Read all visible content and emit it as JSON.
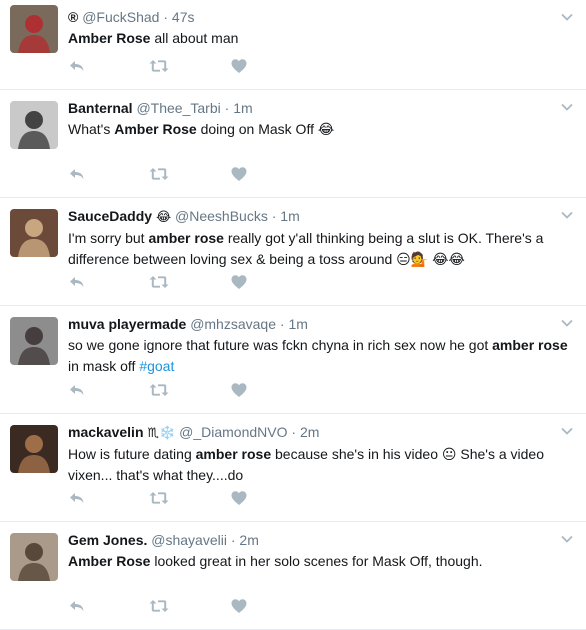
{
  "tweets": [
    {
      "name": "®",
      "name_emoji": "",
      "handle": "@FuckShad",
      "time": "47s",
      "text": [
        {
          "t": "Amber Rose",
          "b": true
        },
        {
          "t": " all about man"
        }
      ],
      "avatar": {
        "bg": "#7a6a5c",
        "fg": "#b8262a"
      }
    },
    {
      "name": "Banternal",
      "name_emoji": "",
      "handle": "@Thee_Tarbi",
      "time": "1m",
      "text": [
        {
          "t": "What's "
        },
        {
          "t": "Amber Rose",
          "b": true
        },
        {
          "t": " doing on Mask Off 😂"
        }
      ],
      "avatar": {
        "bg": "#c9c9c9",
        "fg": "#2b2b2b"
      }
    },
    {
      "name": "SauceDaddy",
      "name_emoji": "😂",
      "handle": "@NeeshBucks",
      "time": "1m",
      "text": [
        {
          "t": "I'm sorry but "
        },
        {
          "t": "amber rose",
          "b": true
        },
        {
          "t": " really got y'all thinking being a slut is OK. There's a difference between loving sex & being a toss around 😑💁 😂😂"
        }
      ],
      "avatar": {
        "bg": "#6b4a3a",
        "fg": "#d8b68c"
      }
    },
    {
      "name": "muva playermade",
      "name_emoji": "",
      "handle": "@mhzsavaqe",
      "time": "1m",
      "text": [
        {
          "t": "so we gone ignore that future was fckn chyna in rich sex now he got "
        },
        {
          "t": "amber rose",
          "b": true
        },
        {
          "t": " in mask off "
        },
        {
          "t": "#goat",
          "h": true
        }
      ],
      "avatar": {
        "bg": "#8d8d8d",
        "fg": "#3a3030"
      }
    },
    {
      "name": "mackavelin",
      "name_emoji": "♏❄️",
      "handle": "@_DiamondNVO",
      "time": "2m",
      "text": [
        {
          "t": "How is future dating "
        },
        {
          "t": "amber rose",
          "b": true
        },
        {
          "t": " because she's in his video 😐 She's a video vixen... that's what they....do"
        }
      ],
      "avatar": {
        "bg": "#3b2a22",
        "fg": "#b07a50"
      }
    },
    {
      "name": "Gem Jones.",
      "name_emoji": "",
      "handle": "@shayavelii",
      "time": "2m",
      "text": [
        {
          "t": "Amber Rose",
          "b": true
        },
        {
          "t": " looked great in her solo scenes for Mask Off, though."
        }
      ],
      "avatar": {
        "bg": "#a99a8a",
        "fg": "#4a3a2e"
      }
    }
  ],
  "colors": {
    "icon": "#aab8c2",
    "meta": "#657786",
    "hashtag": "#1b95e0",
    "divider": "#e6ecf0"
  }
}
